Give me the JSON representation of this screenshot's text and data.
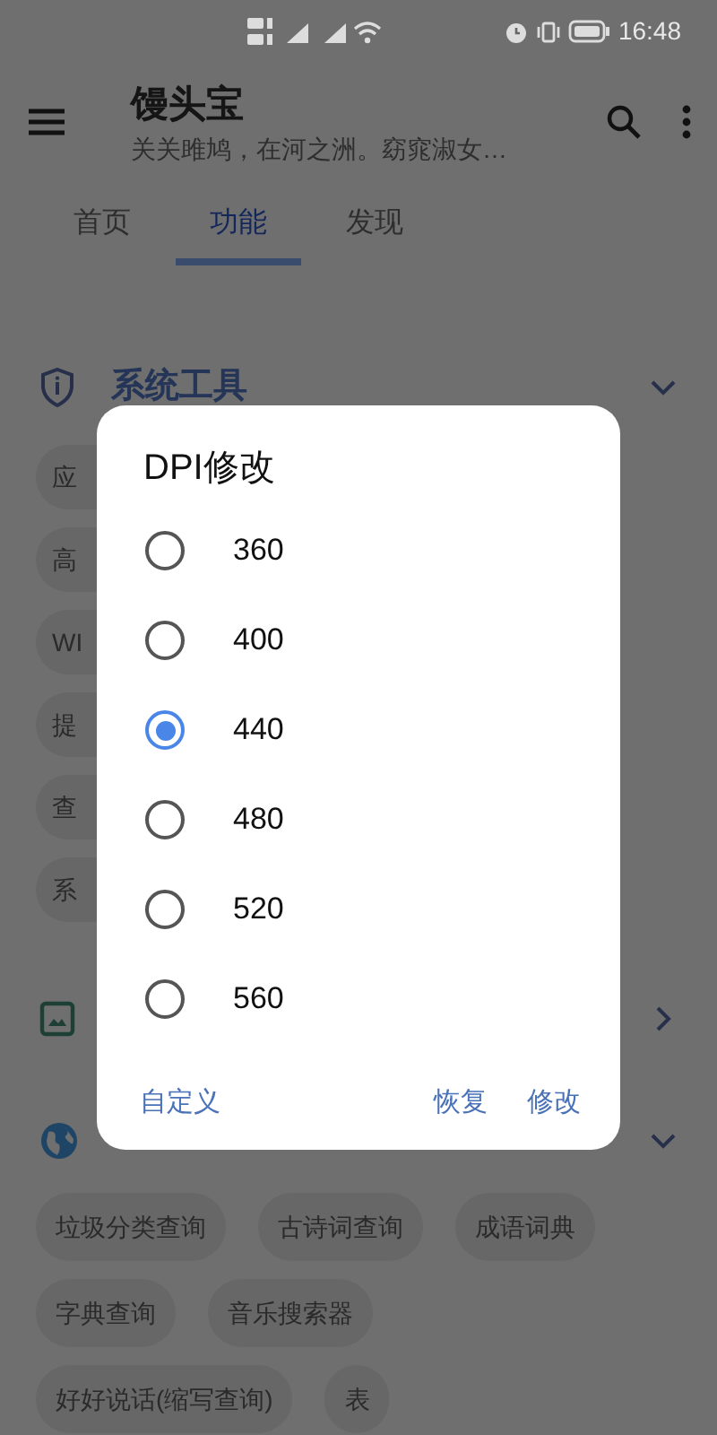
{
  "status_bar": {
    "time": "16:48"
  },
  "app_bar": {
    "title": "馒头宝",
    "subtitle": "关关雎鸠，在河之洲。窈窕淑女…"
  },
  "tabs": [
    {
      "label": "首页",
      "selected": false
    },
    {
      "label": "功能",
      "selected": true
    },
    {
      "label": "发现",
      "selected": false
    }
  ],
  "sections": [
    {
      "title": "系统工具",
      "expanded": true,
      "chips": [
        "应",
        "高",
        "WI",
        "提",
        "查",
        "系"
      ]
    },
    {
      "expanded": false
    },
    {
      "expanded": true,
      "chips": [
        "垃圾分类查询",
        "古诗词查询",
        "成语词典",
        "字典查询",
        "音乐搜索器",
        "好好说话(缩写查询)",
        "表"
      ]
    }
  ],
  "dialog": {
    "title": "DPI修改",
    "options": [
      {
        "label": "360",
        "selected": false
      },
      {
        "label": "400",
        "selected": false
      },
      {
        "label": "440",
        "selected": true
      },
      {
        "label": "480",
        "selected": false
      },
      {
        "label": "520",
        "selected": false
      },
      {
        "label": "560",
        "selected": false
      }
    ],
    "buttons": [
      "自定义",
      "恢复",
      "修改"
    ]
  }
}
